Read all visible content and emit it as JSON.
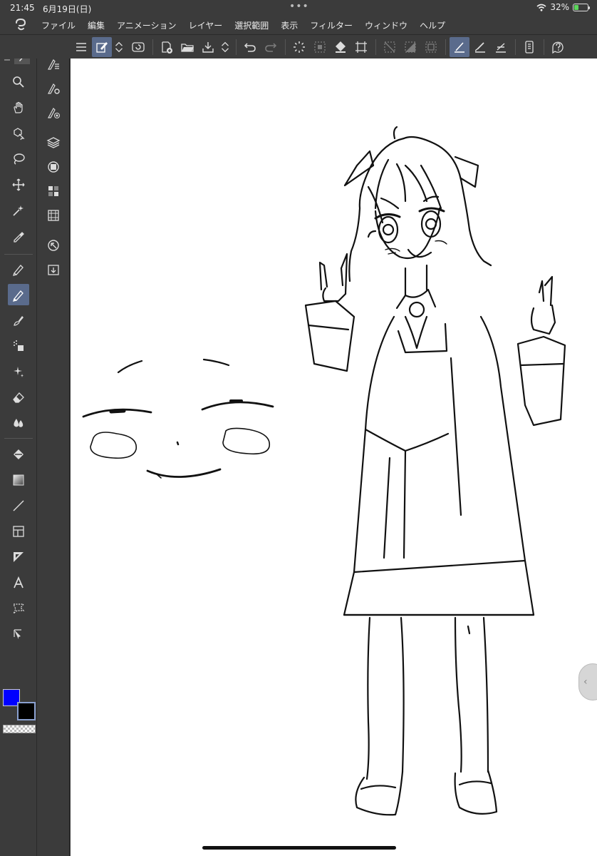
{
  "status": {
    "time": "21:45",
    "date": "6月19日(日)",
    "battery_percent": "32%",
    "battery_level": 0.32,
    "icons": [
      "more-dots-icon",
      "wifi-icon",
      "battery-icon"
    ]
  },
  "menu": {
    "items": [
      "ファイル",
      "編集",
      "アニメーション",
      "レイヤー",
      "選択範囲",
      "表示",
      "フィルター",
      "ウィンドウ",
      "ヘルプ"
    ]
  },
  "toolbar": {
    "collapse_left": "«",
    "collapse_right": "«",
    "expand_right": "›",
    "icons": [
      "menu-icon",
      "edit-mode-icon",
      "up-down-icon",
      "transform-icon",
      "new-canvas-icon",
      "open-folder-icon",
      "save-icon",
      "up-down-icon",
      "undo-icon",
      "redo-icon",
      "loading-icon",
      "select-all-icon",
      "fill-icon",
      "crop-icon",
      "snap-off-icon",
      "snap-gradient-icon",
      "snap-box-icon",
      "snap-ruler-icon",
      "snap-brush-icon",
      "snap-line-icon",
      "device-icon",
      "help-icon"
    ]
  },
  "tools": [
    "zoom-icon",
    "hand-icon",
    "object-icon",
    "lasso-icon",
    "move-icon",
    "magic-wand-icon",
    "eyedropper-icon",
    "pen-icon",
    "pencil-icon",
    "brush-icon",
    "airbrush-icon",
    "decoration-icon",
    "eraser-icon",
    "blend-icon",
    "fill-bucket-icon",
    "gradient-icon",
    "line-icon",
    "frame-icon",
    "ruler-icon",
    "text-icon",
    "balloon-icon",
    "correct-line-icon"
  ],
  "panels": [
    "tool-property-icon",
    "sub-tool-detail-icon",
    "brush-size-icon",
    "layer-icon",
    "layer-property-icon",
    "color-set-icon",
    "timeline-icon",
    "navigator-icon",
    "material-icon"
  ],
  "colors": {
    "main": "#0000ff",
    "sub": "#000000",
    "accent": "#5a6b8c",
    "chrome": "#3b3b3b"
  },
  "canvas": {
    "background": "#ffffff",
    "content": "line-art sketch: chibi face and standing girl"
  }
}
